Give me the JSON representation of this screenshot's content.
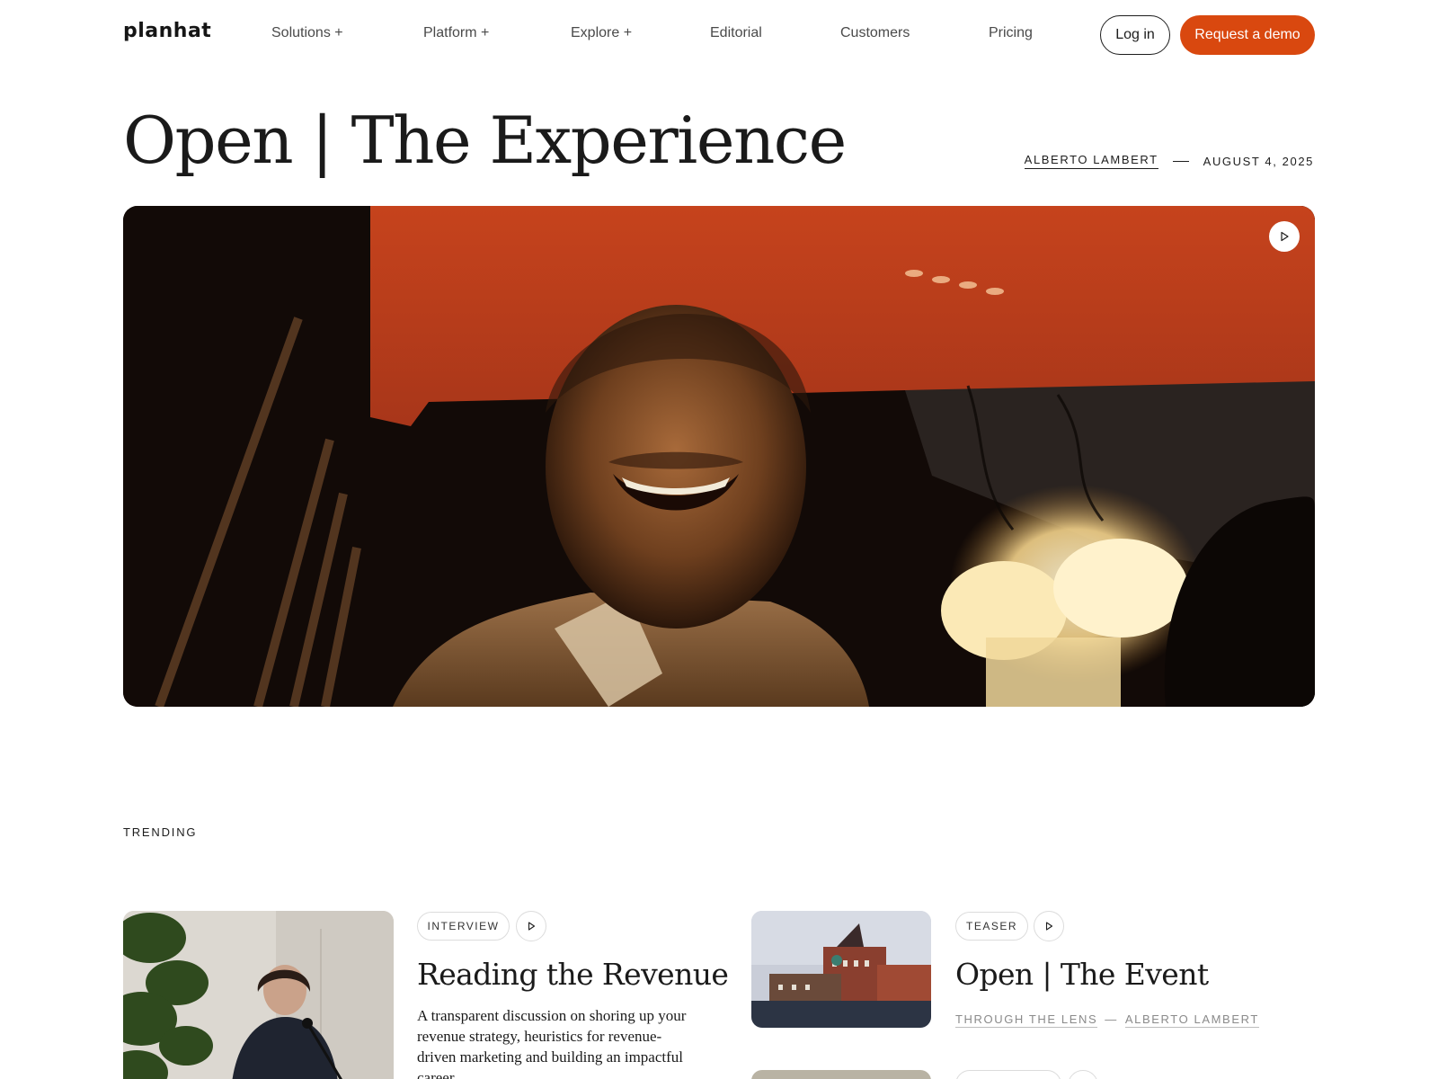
{
  "nav": {
    "logo": "planhat",
    "links": [
      "Solutions +",
      "Platform +",
      "Explore +",
      "Editorial",
      "Customers",
      "Pricing"
    ],
    "login_label": "Log in",
    "demo_label": "Request a demo"
  },
  "hero": {
    "title": "Open | The Experience",
    "author": "ALBERTO LAMBERT",
    "date": "AUGUST 4, 2025"
  },
  "trending": {
    "heading": "TRENDING",
    "cards": [
      {
        "tag": "INTERVIEW",
        "title": "Reading the Revenue",
        "description": "A transparent discussion on shoring up your revenue strategy, heuristics for revenue-driven marketing and building an impactful career"
      },
      {
        "tag": "TEASER",
        "title": "Open | The Event",
        "category": "THROUGH THE LENS",
        "separator": "—",
        "author": "ALBERTO LAMBERT"
      }
    ]
  },
  "colors": {
    "accent": "#d9480f",
    "text": "#1d1d1d",
    "muted": "#8a8a8a"
  },
  "icons": [
    "play-icon"
  ]
}
